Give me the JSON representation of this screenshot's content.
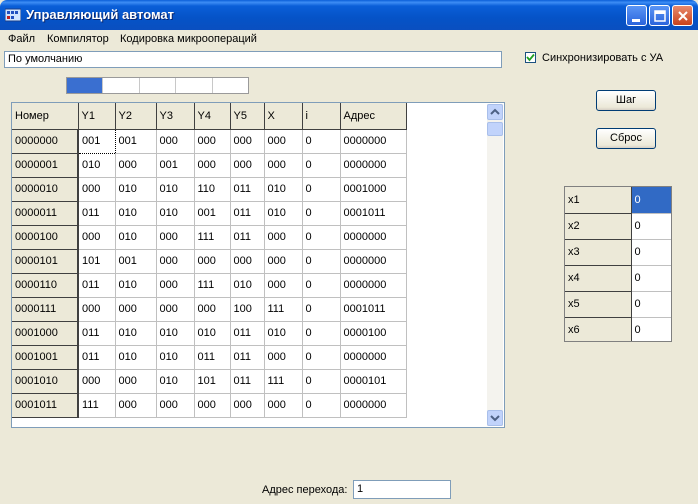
{
  "window": {
    "title": "Управляющий автомат"
  },
  "menu": [
    "Файл",
    "Компилятор",
    "Кодировка микроопераций"
  ],
  "profile_field": {
    "value": "По умолчанию"
  },
  "sync": {
    "label": "Синхронизировать с  УА",
    "checked": true
  },
  "progress": {
    "segments_total": 5,
    "segments_filled": 1
  },
  "buttons": {
    "step": "Шаг",
    "reset": "Сброс"
  },
  "grid": {
    "headers": [
      "Номер",
      "Y1",
      "Y2",
      "Y3",
      "Y4",
      "Y5",
      "X",
      "i",
      "Адрес"
    ],
    "rows": [
      [
        "0000000",
        "001",
        "001",
        "000",
        "000",
        "000",
        "000",
        "0",
        "0000000"
      ],
      [
        "0000001",
        "010",
        "000",
        "001",
        "000",
        "000",
        "000",
        "0",
        "0000000"
      ],
      [
        "0000010",
        "000",
        "010",
        "010",
        "110",
        "011",
        "010",
        "0",
        "0001000"
      ],
      [
        "0000011",
        "011",
        "010",
        "010",
        "001",
        "011",
        "010",
        "0",
        "0001011"
      ],
      [
        "0000100",
        "000",
        "010",
        "000",
        "111",
        "011",
        "000",
        "0",
        "0000000"
      ],
      [
        "0000101",
        "101",
        "001",
        "000",
        "000",
        "000",
        "000",
        "0",
        "0000000"
      ],
      [
        "0000110",
        "011",
        "010",
        "000",
        "111",
        "010",
        "000",
        "0",
        "0000000"
      ],
      [
        "0000111",
        "000",
        "000",
        "000",
        "000",
        "100",
        "111",
        "0",
        "0001011"
      ],
      [
        "0001000",
        "011",
        "010",
        "010",
        "010",
        "011",
        "010",
        "0",
        "0000100"
      ],
      [
        "0001001",
        "011",
        "010",
        "010",
        "011",
        "011",
        "000",
        "0",
        "0000000"
      ],
      [
        "0001010",
        "000",
        "000",
        "010",
        "101",
        "011",
        "111",
        "0",
        "0000101"
      ],
      [
        "0001011",
        "111",
        "000",
        "000",
        "000",
        "000",
        "000",
        "0",
        "0000000"
      ]
    ]
  },
  "x_inputs": [
    {
      "name": "x1",
      "value": "0"
    },
    {
      "name": "x2",
      "value": "0"
    },
    {
      "name": "x3",
      "value": "0"
    },
    {
      "name": "x4",
      "value": "0"
    },
    {
      "name": "x5",
      "value": "0"
    },
    {
      "name": "x6",
      "value": "0"
    }
  ],
  "address": {
    "label": "Адрес перехода:",
    "value": "1"
  },
  "icons": [
    "app-icon",
    "minimize-icon",
    "maximize-icon",
    "close-icon",
    "checkmark-icon",
    "scroll-up-icon",
    "scroll-down-icon"
  ],
  "colors": {
    "titlebar": "#0a5fd8",
    "selection": "#316ac5",
    "progress": "#3a6fd0"
  }
}
